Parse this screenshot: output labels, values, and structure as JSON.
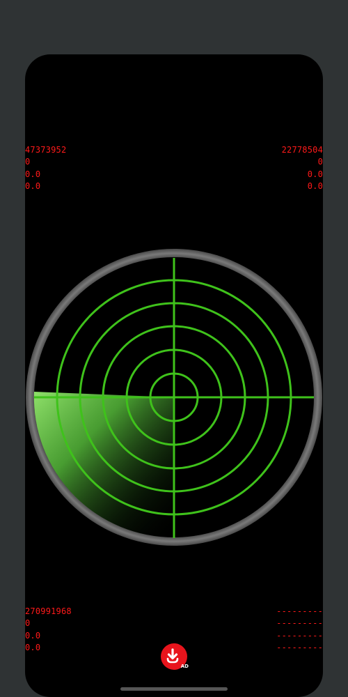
{
  "readouts": {
    "top_left": [
      "47373952",
      "0",
      "0.0",
      "0.0"
    ],
    "top_right": [
      "22778504",
      "0",
      "0.0",
      "0.0"
    ],
    "bottom_left": [
      "270991968",
      "0",
      "0.0",
      "0.0"
    ],
    "bottom_right": [
      "---------",
      "---------",
      "---------",
      "---------"
    ]
  },
  "colors": {
    "readout_text": "#ff1a1a",
    "radar_grid": "#3fc21b",
    "radar_bezel": "#6b6b6b",
    "ad_button": "#e8141c"
  },
  "icons": {
    "ad_button": "download-icon"
  },
  "ad_button": {
    "label": "AD"
  }
}
